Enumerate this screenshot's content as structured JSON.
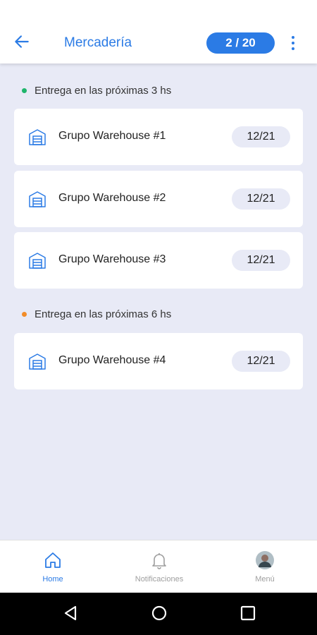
{
  "header": {
    "title": "Mercadería",
    "counter": "2 / 20"
  },
  "sections": [
    {
      "label": "Entrega en las próximas 3 hs",
      "dot_color": "#1fb56b",
      "items": [
        {
          "name": "Grupo Warehouse #1",
          "date": "12/21"
        },
        {
          "name": "Grupo Warehouse #2",
          "date": "12/21"
        },
        {
          "name": "Grupo Warehouse #3",
          "date": "12/21"
        }
      ]
    },
    {
      "label": "Entrega en las próximas 6 hs",
      "dot_color": "#f28c28",
      "items": [
        {
          "name": "Grupo Warehouse #4",
          "date": "12/21"
        }
      ]
    }
  ],
  "bottom_nav": {
    "home": "Home",
    "notifications": "Notificaciones",
    "menu": "Menú"
  },
  "colors": {
    "accent": "#2b7be5",
    "background": "#e8eaf6",
    "inactive": "#9e9e9e"
  },
  "icons": {
    "back": "arrow-left-icon",
    "more": "more-vertical-icon",
    "warehouse": "warehouse-icon",
    "home": "home-icon",
    "notifications": "bell-icon",
    "menu": "avatar"
  }
}
